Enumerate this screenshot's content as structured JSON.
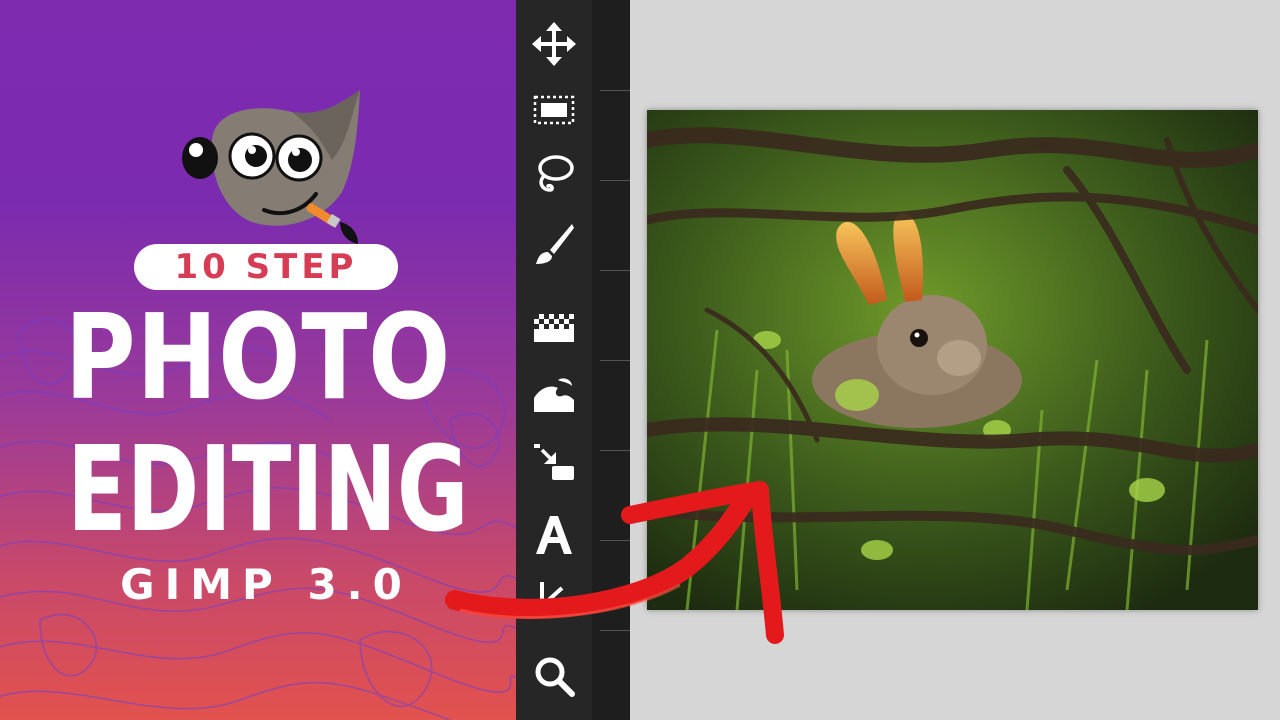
{
  "promo": {
    "badge": "10 STEP",
    "line1": "PHOTO",
    "line2": "EDITING",
    "line3": "GIMP 3.0"
  },
  "toolbox": {
    "tools": [
      "move-tool",
      "rectangle-select-tool",
      "lasso-tool",
      "paintbrush-tool",
      "gradient-tool",
      "warp-transform-tool",
      "paste-layer-tool",
      "text-tool",
      "measure-tool",
      "zoom-tool"
    ]
  },
  "colors": {
    "promo_top": "#7e2bb0",
    "promo_bottom": "#e2524e",
    "badge_text": "#d63d55",
    "toolbox_bg": "#262626",
    "canvas_bg": "#d6d6d6",
    "arrow": "#e3191c"
  }
}
